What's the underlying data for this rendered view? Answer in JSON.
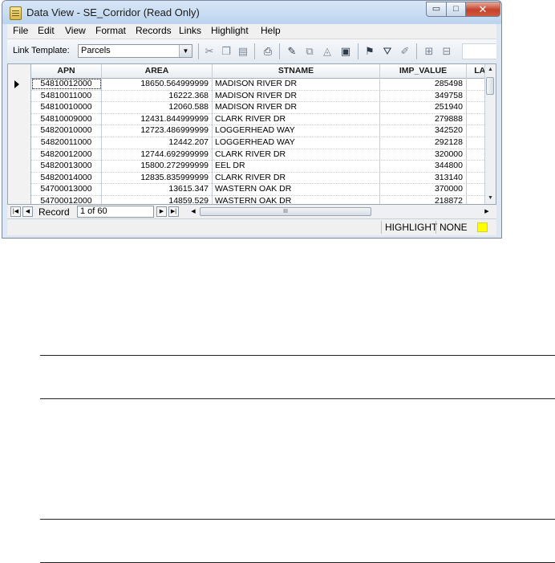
{
  "window": {
    "title": "Data View - SE_Corridor (Read Only)",
    "controls": {
      "minimize": "▭",
      "maximize": "□",
      "close": "✕"
    }
  },
  "menu": [
    "File",
    "Edit",
    "View",
    "Format",
    "Records",
    "Links",
    "Highlight",
    "Help"
  ],
  "toolbar": {
    "link_template_label": "Link Template:",
    "link_template_value": "Parcels",
    "icons": [
      "cut-icon",
      "copy-icon",
      "paste-icon",
      "print-icon",
      "highlight-icon",
      "copy-records-icon",
      "clear-icon",
      "select-icon",
      "flag-icon",
      "filter-icon",
      "edit-filter-icon",
      "zoom-in-icon",
      "zoom-out-icon"
    ]
  },
  "table": {
    "columns": [
      "APN",
      "AREA",
      "STNAME",
      "IMP_VALUE",
      "LAN"
    ],
    "rows": [
      [
        "54810012000",
        "18650.564999999",
        "MADISON RIVER DR",
        "285498"
      ],
      [
        "54810011000",
        "16222.368",
        "MADISON RIVER DR",
        "349758"
      ],
      [
        "54810010000",
        "12060.588",
        "MADISON RIVER DR",
        "251940"
      ],
      [
        "54810009000",
        "12431.844999999",
        "CLARK RIVER DR",
        "279888"
      ],
      [
        "54820010000",
        "12723.486999999",
        "LOGGERHEAD WAY",
        "342520"
      ],
      [
        "54820011000",
        "12442.207",
        "LOGGERHEAD WAY",
        "292128"
      ],
      [
        "54820012000",
        "12744.692999999",
        "CLARK RIVER DR",
        "320000"
      ],
      [
        "54820013000",
        "15800.272999999",
        "EEL DR",
        "344800"
      ],
      [
        "54820014000",
        "12835.835999999",
        "CLARK RIVER DR",
        "313140"
      ],
      [
        "54700013000",
        "13615.347",
        "WASTERN OAK DR",
        "370000"
      ],
      [
        "54700012000",
        "14859.529",
        "WASTERN OAK DR",
        "218872"
      ]
    ]
  },
  "record_nav": {
    "label": "Record",
    "value": "1 of 60",
    "scroll_grip": "III"
  },
  "status": {
    "highlight_label": "HIGHLIGHT",
    "highlight_value": "NONE",
    "highlight_color": "#ffff00"
  }
}
